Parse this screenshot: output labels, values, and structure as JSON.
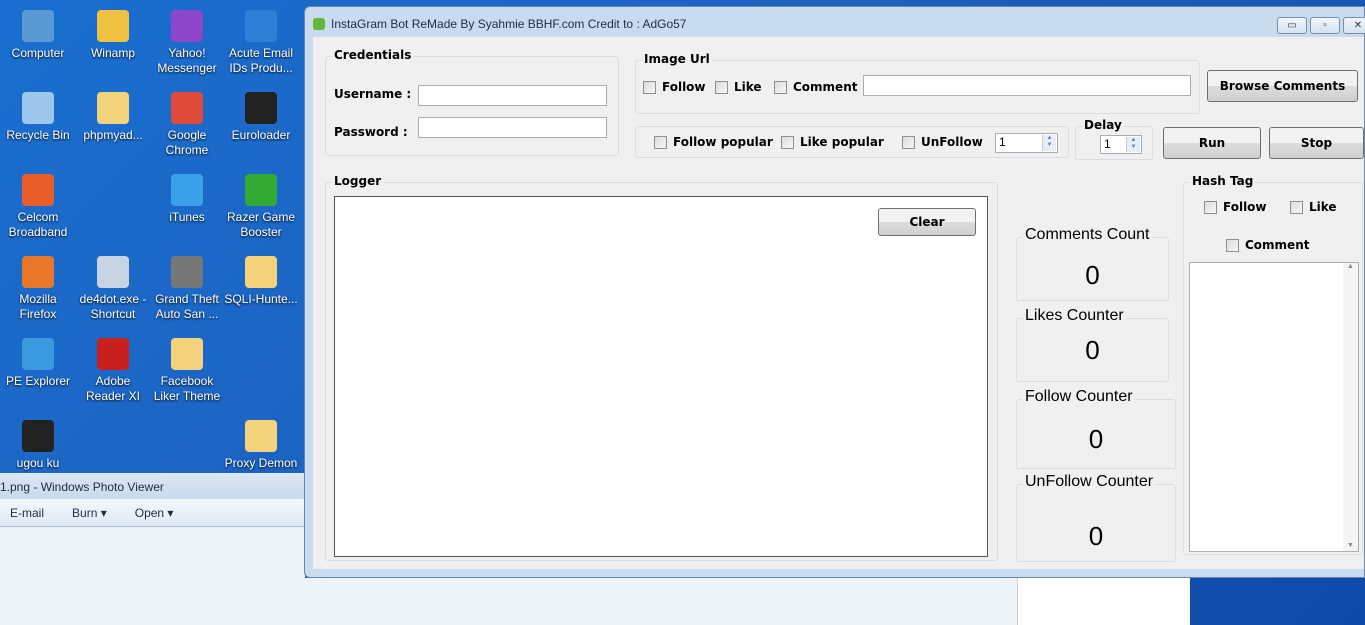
{
  "desktop_icons": [
    {
      "label": "Computer",
      "color": "#5b9bd5"
    },
    {
      "label": "Winamp",
      "color": "#f0c040"
    },
    {
      "label": "Yahoo! Messenger",
      "color": "#8b46c9"
    },
    {
      "label": "Acute Email IDs Produ...",
      "color": "#2f7fd8"
    },
    {
      "label": "Recycle Bin",
      "color": "#9cc7ea"
    },
    {
      "label": "phpmyad...",
      "color": "#f2d27a"
    },
    {
      "label": "Google Chrome",
      "color": "#e04a3a"
    },
    {
      "label": "Euroloader",
      "color": "#222222"
    },
    {
      "label": "Celcom Broadband",
      "color": "#e85d2a"
    },
    {
      "label": "iTunes",
      "color": "#3aa0e8"
    },
    {
      "label": "Razer Game Booster",
      "color": "#33aa33"
    },
    {
      "label": "Mozilla Firefox",
      "color": "#e8772a"
    },
    {
      "label": "de4dot.exe - Shortcut",
      "color": "#c8d4e4"
    },
    {
      "label": "Grand Theft Auto San ...",
      "color": "#777777"
    },
    {
      "label": "SQLI-Hunte...",
      "color": "#f2d27a"
    },
    {
      "label": "PE Explorer",
      "color": "#3a9adf"
    },
    {
      "label": "Adobe Reader XI",
      "color": "#c8201e"
    },
    {
      "label": "Facebook Liker Theme",
      "color": "#f2d27a"
    },
    {
      "label": "ugou ku",
      "color": "#222222"
    },
    {
      "label": "Proxy Demon",
      "color": "#f2d27a"
    }
  ],
  "photo_viewer": {
    "title": "1.png - Windows Photo Viewer",
    "menu": [
      "E-mail",
      "Burn",
      "Open"
    ]
  },
  "window": {
    "title": "InstaGram Bot ReMade By Syahmie BBHF.com Credit to : AdGo57",
    "controls": {
      "minimize": "▭",
      "maximize": "▫",
      "close": "✕"
    },
    "credentials": {
      "legend": "Credentials",
      "username_label": "Username :",
      "password_label": "Password :",
      "username": "",
      "password": ""
    },
    "image_url": {
      "legend": "Image Url",
      "follow": "Follow",
      "like": "Like",
      "comment": "Comment",
      "url": ""
    },
    "browse_comments": "Browse Comments",
    "popular": {
      "follow_popular": "Follow popular",
      "like_popular": "Like popular",
      "unfollow": "UnFollow",
      "unfollow_value": "1"
    },
    "delay": {
      "legend": "Delay",
      "value": "1"
    },
    "run": "Run",
    "stop": "Stop",
    "logger": {
      "legend": "Logger",
      "clear": "Clear"
    },
    "counters": [
      {
        "label": "Comments Count",
        "value": "0"
      },
      {
        "label": "Likes Counter",
        "value": "0"
      },
      {
        "label": "Follow Counter",
        "value": "0"
      },
      {
        "label": "UnFollow Counter",
        "value": "0"
      }
    ],
    "hashtag": {
      "legend": "Hash Tag",
      "follow": "Follow",
      "like": "Like",
      "comment": "Comment"
    }
  }
}
